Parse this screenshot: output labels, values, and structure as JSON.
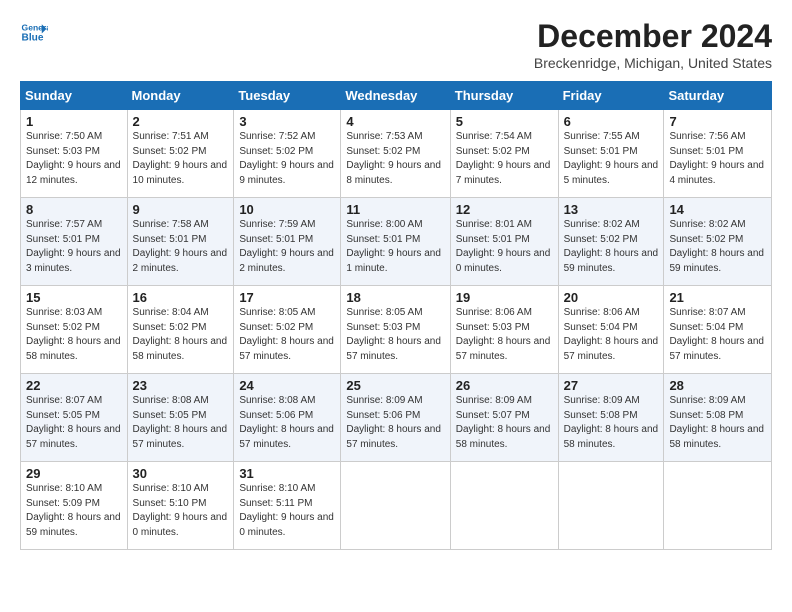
{
  "header": {
    "logo_line1": "General",
    "logo_line2": "Blue",
    "title": "December 2024",
    "subtitle": "Breckenridge, Michigan, United States"
  },
  "weekdays": [
    "Sunday",
    "Monday",
    "Tuesday",
    "Wednesday",
    "Thursday",
    "Friday",
    "Saturday"
  ],
  "weeks": [
    [
      {
        "day": "1",
        "sunrise": "7:50 AM",
        "sunset": "5:03 PM",
        "daylight": "9 hours and 12 minutes."
      },
      {
        "day": "2",
        "sunrise": "7:51 AM",
        "sunset": "5:02 PM",
        "daylight": "9 hours and 10 minutes."
      },
      {
        "day": "3",
        "sunrise": "7:52 AM",
        "sunset": "5:02 PM",
        "daylight": "9 hours and 9 minutes."
      },
      {
        "day": "4",
        "sunrise": "7:53 AM",
        "sunset": "5:02 PM",
        "daylight": "9 hours and 8 minutes."
      },
      {
        "day": "5",
        "sunrise": "7:54 AM",
        "sunset": "5:02 PM",
        "daylight": "9 hours and 7 minutes."
      },
      {
        "day": "6",
        "sunrise": "7:55 AM",
        "sunset": "5:01 PM",
        "daylight": "9 hours and 5 minutes."
      },
      {
        "day": "7",
        "sunrise": "7:56 AM",
        "sunset": "5:01 PM",
        "daylight": "9 hours and 4 minutes."
      }
    ],
    [
      {
        "day": "8",
        "sunrise": "7:57 AM",
        "sunset": "5:01 PM",
        "daylight": "9 hours and 3 minutes."
      },
      {
        "day": "9",
        "sunrise": "7:58 AM",
        "sunset": "5:01 PM",
        "daylight": "9 hours and 2 minutes."
      },
      {
        "day": "10",
        "sunrise": "7:59 AM",
        "sunset": "5:01 PM",
        "daylight": "9 hours and 2 minutes."
      },
      {
        "day": "11",
        "sunrise": "8:00 AM",
        "sunset": "5:01 PM",
        "daylight": "9 hours and 1 minute."
      },
      {
        "day": "12",
        "sunrise": "8:01 AM",
        "sunset": "5:01 PM",
        "daylight": "9 hours and 0 minutes."
      },
      {
        "day": "13",
        "sunrise": "8:02 AM",
        "sunset": "5:02 PM",
        "daylight": "8 hours and 59 minutes."
      },
      {
        "day": "14",
        "sunrise": "8:02 AM",
        "sunset": "5:02 PM",
        "daylight": "8 hours and 59 minutes."
      }
    ],
    [
      {
        "day": "15",
        "sunrise": "8:03 AM",
        "sunset": "5:02 PM",
        "daylight": "8 hours and 58 minutes."
      },
      {
        "day": "16",
        "sunrise": "8:04 AM",
        "sunset": "5:02 PM",
        "daylight": "8 hours and 58 minutes."
      },
      {
        "day": "17",
        "sunrise": "8:05 AM",
        "sunset": "5:02 PM",
        "daylight": "8 hours and 57 minutes."
      },
      {
        "day": "18",
        "sunrise": "8:05 AM",
        "sunset": "5:03 PM",
        "daylight": "8 hours and 57 minutes."
      },
      {
        "day": "19",
        "sunrise": "8:06 AM",
        "sunset": "5:03 PM",
        "daylight": "8 hours and 57 minutes."
      },
      {
        "day": "20",
        "sunrise": "8:06 AM",
        "sunset": "5:04 PM",
        "daylight": "8 hours and 57 minutes."
      },
      {
        "day": "21",
        "sunrise": "8:07 AM",
        "sunset": "5:04 PM",
        "daylight": "8 hours and 57 minutes."
      }
    ],
    [
      {
        "day": "22",
        "sunrise": "8:07 AM",
        "sunset": "5:05 PM",
        "daylight": "8 hours and 57 minutes."
      },
      {
        "day": "23",
        "sunrise": "8:08 AM",
        "sunset": "5:05 PM",
        "daylight": "8 hours and 57 minutes."
      },
      {
        "day": "24",
        "sunrise": "8:08 AM",
        "sunset": "5:06 PM",
        "daylight": "8 hours and 57 minutes."
      },
      {
        "day": "25",
        "sunrise": "8:09 AM",
        "sunset": "5:06 PM",
        "daylight": "8 hours and 57 minutes."
      },
      {
        "day": "26",
        "sunrise": "8:09 AM",
        "sunset": "5:07 PM",
        "daylight": "8 hours and 58 minutes."
      },
      {
        "day": "27",
        "sunrise": "8:09 AM",
        "sunset": "5:08 PM",
        "daylight": "8 hours and 58 minutes."
      },
      {
        "day": "28",
        "sunrise": "8:09 AM",
        "sunset": "5:08 PM",
        "daylight": "8 hours and 58 minutes."
      }
    ],
    [
      {
        "day": "29",
        "sunrise": "8:10 AM",
        "sunset": "5:09 PM",
        "daylight": "8 hours and 59 minutes."
      },
      {
        "day": "30",
        "sunrise": "8:10 AM",
        "sunset": "5:10 PM",
        "daylight": "9 hours and 0 minutes."
      },
      {
        "day": "31",
        "sunrise": "8:10 AM",
        "sunset": "5:11 PM",
        "daylight": "9 hours and 0 minutes."
      },
      null,
      null,
      null,
      null
    ]
  ]
}
